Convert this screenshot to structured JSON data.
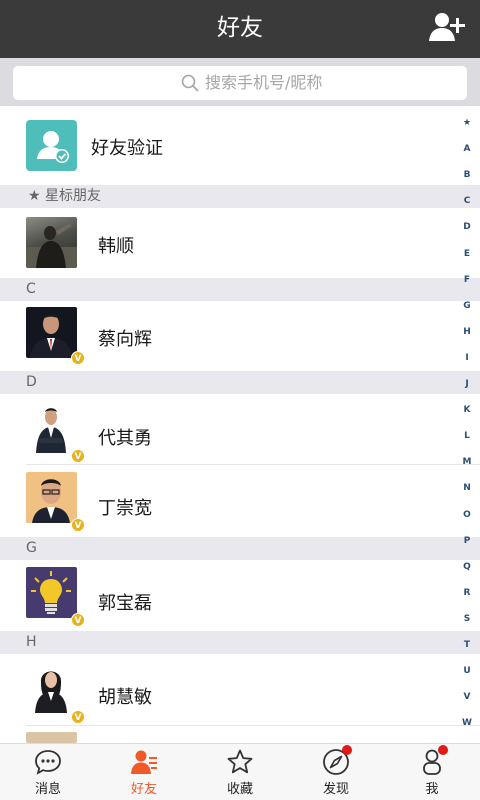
{
  "header": {
    "title": "好友"
  },
  "search": {
    "placeholder": "搜索手机号/昵称"
  },
  "verify": {
    "label": "好友验证"
  },
  "sections": {
    "starred": "★ 星标朋友",
    "c": "C",
    "d": "D",
    "g": "G",
    "h": "H"
  },
  "contacts": [
    {
      "name": "韩顺",
      "verified": false
    },
    {
      "name": "蔡向辉",
      "verified": true
    },
    {
      "name": "代其勇",
      "verified": true
    },
    {
      "name": "丁崇宽",
      "verified": true
    },
    {
      "name": "郭宝磊",
      "verified": true
    },
    {
      "name": "胡慧敏",
      "verified": true
    }
  ],
  "verified_badge": "V",
  "alphabet": [
    "★",
    "A",
    "B",
    "C",
    "D",
    "E",
    "F",
    "G",
    "H",
    "I",
    "J",
    "K",
    "L",
    "M",
    "N",
    "O",
    "P",
    "Q",
    "R",
    "S",
    "T",
    "U",
    "V",
    "W"
  ],
  "tabs": [
    {
      "label": "消息",
      "icon": "chat-bubble-icon",
      "active": false
    },
    {
      "label": "好友",
      "icon": "friends-icon",
      "active": true
    },
    {
      "label": "收藏",
      "icon": "star-icon",
      "active": false
    },
    {
      "label": "发现",
      "icon": "compass-icon",
      "active": false,
      "badge": true
    },
    {
      "label": "我",
      "icon": "person-icon",
      "active": false,
      "badge": true
    }
  ],
  "colors": {
    "header_bg": "#3a3a3a",
    "accent": "#f05a28",
    "verify_teal": "#4fbdba",
    "badge_gold": "#e8b21c",
    "notification_red": "#e01818",
    "index_blue": "#2d4f73"
  }
}
